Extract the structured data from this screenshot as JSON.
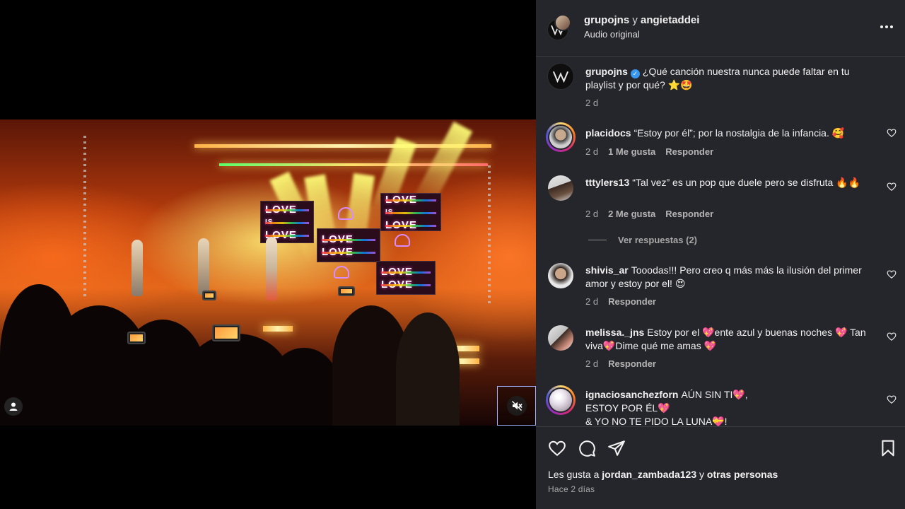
{
  "post": {
    "author_primary": "grupojns",
    "conjunction": "y",
    "author_secondary": "angietaddei",
    "audio_label": "Audio original"
  },
  "media": {
    "led_words": [
      "LOVE",
      "IS",
      "LOVE"
    ]
  },
  "caption": {
    "username": "grupojns",
    "text": "¿Qué canción nuestra nunca puede faltar en tu playlist y por qué? ⭐🤩",
    "time": "2 d"
  },
  "comments": [
    {
      "username": "placidocs",
      "text": "“Estoy por él”; por la nostalgia de la infancia. 🥰",
      "time": "2 d",
      "likes": "1 Me gusta",
      "reply": "Responder"
    },
    {
      "username": "tttylers13",
      "text": "“Tal vez” es un pop que duele pero se disfruta 🔥🔥",
      "time": "2 d",
      "likes": "2 Me gusta",
      "reply": "Responder",
      "view_replies": "Ver respuestas (2)"
    },
    {
      "username": "shivis_ar",
      "text": "Tooodas!!! Pero creo q más más la ilusión del primer amor y estoy por el! 😍",
      "time": "2 d",
      "reply": "Responder"
    },
    {
      "username": "melissa._jns",
      "text": "Estoy por el 💖ente azul y buenas noches 💖 Tan viva💖Dime qué me amas 💖",
      "time": "2 d",
      "reply": "Responder"
    },
    {
      "username": "ignaciosanchezforn",
      "text_lines": [
        "AÚN SIN TI💖,",
        "ESTOY POR ÉL💖",
        "& YO NO TE PIDO LA LUNA💝!"
      ]
    }
  ],
  "footer": {
    "likes_prefix": "Les gusta a",
    "likes_user": "jordan_zambada123",
    "likes_conj": "y",
    "likes_rest": "otras personas",
    "timestamp": "Hace 2 días"
  },
  "icons": {
    "like": "heart-icon",
    "comment": "comment-icon",
    "share": "share-icon",
    "save": "bookmark-icon",
    "mute": "muted-speaker-icon",
    "tags": "user-tag-icon",
    "more": "more-dots-icon"
  },
  "colors": {
    "panel_bg": "#25262b",
    "verified": "#3897f0",
    "story_ring": "#d62976"
  }
}
